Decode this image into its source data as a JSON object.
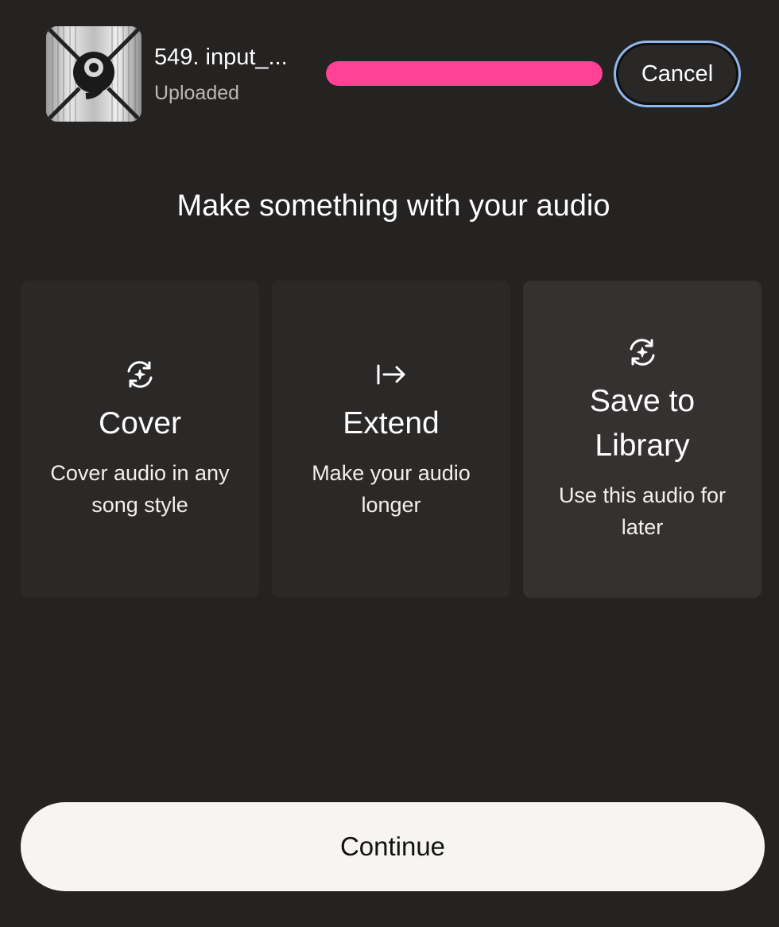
{
  "upload": {
    "file_name": "549. input_...",
    "status": "Uploaded",
    "progress": 1.0,
    "cancel_label": "Cancel"
  },
  "heading": "Make something with your audio",
  "options": [
    {
      "icon": "sparkle-cycle-icon",
      "title": "Cover",
      "description": "Cover audio in any song style"
    },
    {
      "icon": "extend-arrow-icon",
      "title": "Extend",
      "description": "Make your audio longer"
    },
    {
      "icon": "sparkle-cycle-icon",
      "title": "Save to Library",
      "description": "Use this audio for later"
    }
  ],
  "continue_label": "Continue",
  "colors": {
    "background": "#252222",
    "progress": "#ff4295",
    "focus_ring": "#8fb8ee",
    "card": "#2b2828",
    "card_selected": "#353131",
    "continue_bg": "#f7f5f2"
  }
}
